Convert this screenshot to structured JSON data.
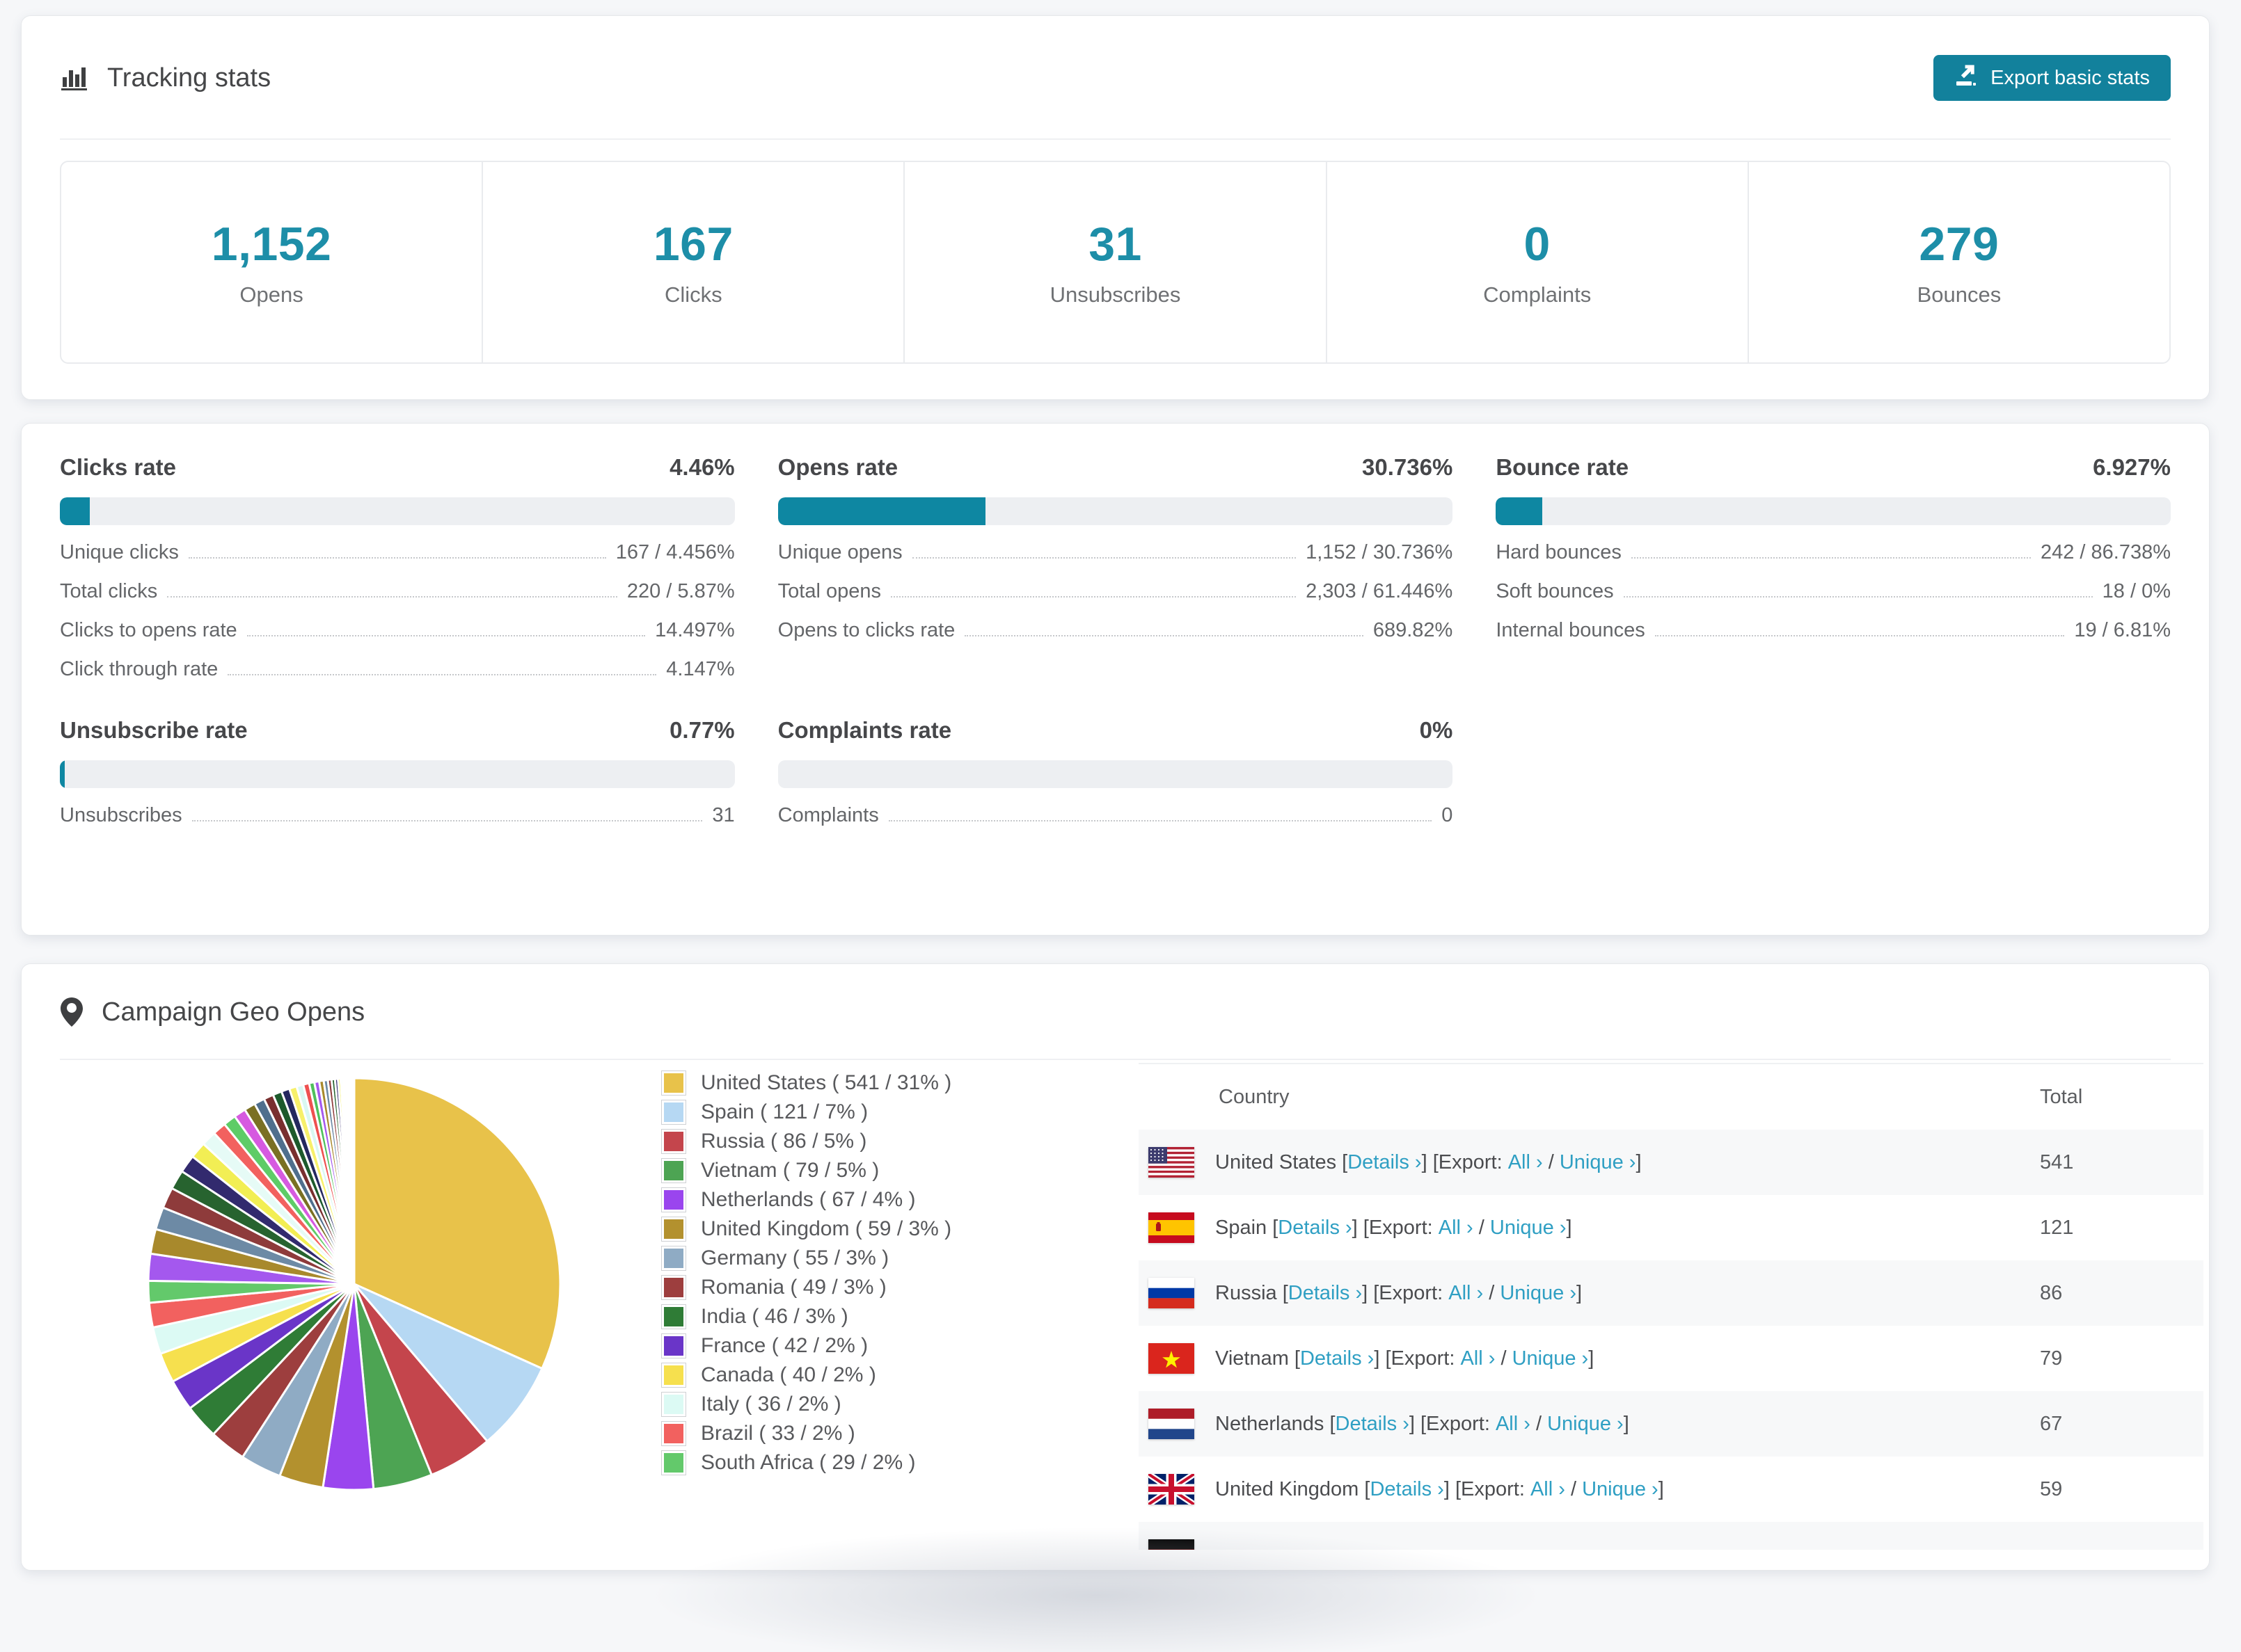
{
  "tracking_card": {
    "title": "Tracking stats",
    "export_button": {
      "label": "Export basic stats"
    },
    "accent_color": "#1d8ea8",
    "button_color": "#12819c",
    "stats": [
      {
        "value": "1,152",
        "label": "Opens"
      },
      {
        "value": "167",
        "label": "Clicks"
      },
      {
        "value": "31",
        "label": "Unsubscribes"
      },
      {
        "value": "0",
        "label": "Complaints"
      },
      {
        "value": "279",
        "label": "Bounces"
      }
    ]
  },
  "rates_card": {
    "bar_fill_color": "#0e87a2",
    "blocks": [
      {
        "title": "Clicks rate",
        "value": "4.46%",
        "percent": 4.46,
        "rows": [
          {
            "label": "Unique clicks",
            "value": "167 / 4.456%"
          },
          {
            "label": "Total clicks",
            "value": "220 / 5.87%"
          },
          {
            "label": "Clicks to opens rate",
            "value": "14.497%"
          },
          {
            "label": "Click through rate",
            "value": "4.147%"
          }
        ]
      },
      {
        "title": "Opens rate",
        "value": "30.736%",
        "percent": 30.736,
        "rows": [
          {
            "label": "Unique opens",
            "value": "1,152 / 30.736%"
          },
          {
            "label": "Total opens",
            "value": "2,303 / 61.446%"
          },
          {
            "label": "Opens to clicks rate",
            "value": "689.82%"
          }
        ]
      },
      {
        "title": "Bounce rate",
        "value": "6.927%",
        "percent": 6.927,
        "rows": [
          {
            "label": "Hard bounces",
            "value": "242 / 86.738%"
          },
          {
            "label": "Soft bounces",
            "value": "18 / 0%"
          },
          {
            "label": "Internal bounces",
            "value": "19 / 6.81%"
          }
        ]
      },
      {
        "title": "Unsubscribe rate",
        "value": "0.77%",
        "percent": 0.77,
        "rows": [
          {
            "label": "Unsubscribes",
            "value": "31"
          }
        ]
      },
      {
        "title": "Complaints rate",
        "value": "0%",
        "percent": 0,
        "rows": [
          {
            "label": "Complaints",
            "value": "0"
          }
        ]
      }
    ]
  },
  "geo_card": {
    "title": "Campaign Geo Opens",
    "table": {
      "headers": [
        "Country",
        "Total"
      ],
      "link_labels": {
        "open": "[",
        "close": "]",
        "details": "Details ›",
        "export": "Export:",
        "all": "All ›",
        "slash": "/",
        "unique": "Unique ›"
      },
      "rows": [
        {
          "flag": "us",
          "country": "United States",
          "total": "541"
        },
        {
          "flag": "es",
          "country": "Spain",
          "total": "121"
        },
        {
          "flag": "ru",
          "country": "Russia",
          "total": "86"
        },
        {
          "flag": "vn",
          "country": "Vietnam",
          "total": "79"
        },
        {
          "flag": "nl",
          "country": "Netherlands",
          "total": "67"
        },
        {
          "flag": "gb",
          "country": "United Kingdom",
          "total": "59"
        },
        {
          "flag": "de",
          "country": "",
          "total": "",
          "partial": true
        }
      ]
    }
  },
  "chart_data": {
    "type": "pie",
    "title": "Campaign Geo Opens",
    "legend_position": "right-of-pie",
    "start_angle": "12 o'clock, clockwise",
    "slices": [
      {
        "label": "United States",
        "value": 541,
        "pct": 31,
        "color": "#e8c24a",
        "legend": "United States ( 541 / 31% )"
      },
      {
        "label": "Spain",
        "value": 121,
        "pct": 7,
        "color": "#b6d8f3",
        "legend": "Spain ( 121 / 7% )"
      },
      {
        "label": "Russia",
        "value": 86,
        "pct": 5,
        "color": "#c4454c",
        "legend": "Russia ( 86 / 5% )"
      },
      {
        "label": "Vietnam",
        "value": 79,
        "pct": 5,
        "color": "#4da453",
        "legend": "Vietnam ( 79 / 5% )"
      },
      {
        "label": "Netherlands",
        "value": 67,
        "pct": 4,
        "color": "#9a45ee",
        "legend": "Netherlands ( 67 / 4% )"
      },
      {
        "label": "United Kingdom",
        "value": 59,
        "pct": 3,
        "color": "#b3912e",
        "legend": "United Kingdom ( 59 / 3% )"
      },
      {
        "label": "Germany",
        "value": 55,
        "pct": 3,
        "color": "#8fabc4",
        "legend": "Germany ( 55 / 3% )"
      },
      {
        "label": "Romania",
        "value": 49,
        "pct": 3,
        "color": "#9d3e3e",
        "legend": "Romania ( 49 / 3% )"
      },
      {
        "label": "India",
        "value": 46,
        "pct": 3,
        "color": "#2f7c36",
        "legend": "India ( 46 / 3% )"
      },
      {
        "label": "France",
        "value": 42,
        "pct": 2,
        "color": "#6a35c8",
        "legend": "France ( 42 / 2% )"
      },
      {
        "label": "Canada",
        "value": 40,
        "pct": 2,
        "color": "#f6e04e",
        "legend": "Canada ( 40 / 2% )"
      },
      {
        "label": "Italy",
        "value": 36,
        "pct": 2,
        "color": "#dcfaf4",
        "legend": "Italy ( 36 / 2% )"
      },
      {
        "label": "Brazil",
        "value": 33,
        "pct": 2,
        "color": "#f2615f",
        "legend": "Brazil ( 33 / 2% )"
      },
      {
        "label": "South Africa",
        "value": 29,
        "pct": 2,
        "color": "#63c96b",
        "legend": "South Africa ( 29 / 2% )"
      }
    ],
    "unlabeled_small_slices": {
      "values": [
        36,
        33,
        30,
        28,
        26,
        24,
        22,
        20,
        18,
        17,
        16,
        15,
        14,
        13,
        12,
        11,
        10,
        9,
        8,
        7,
        6.5,
        6,
        5.5,
        5,
        4.5,
        4,
        3.5,
        3,
        2.5,
        2,
        1.8,
        1.6,
        1.4,
        1.2,
        1,
        0.9,
        0.8,
        0.7,
        0.6,
        0.5
      ],
      "palette": [
        "#a458ee",
        "#a8892c",
        "#6d8aa5",
        "#8e3b3b",
        "#27632f",
        "#322a6e",
        "#f2ee54",
        "#e6fbf6",
        "#f2615f",
        "#5ecc67",
        "#d65ae0",
        "#7a7023",
        "#4f6f8d",
        "#792f2f",
        "#1d5a2c",
        "#24285f",
        "#f7f06a",
        "#d9f8f2",
        "#ee5050",
        "#4fc05c"
      ]
    }
  }
}
